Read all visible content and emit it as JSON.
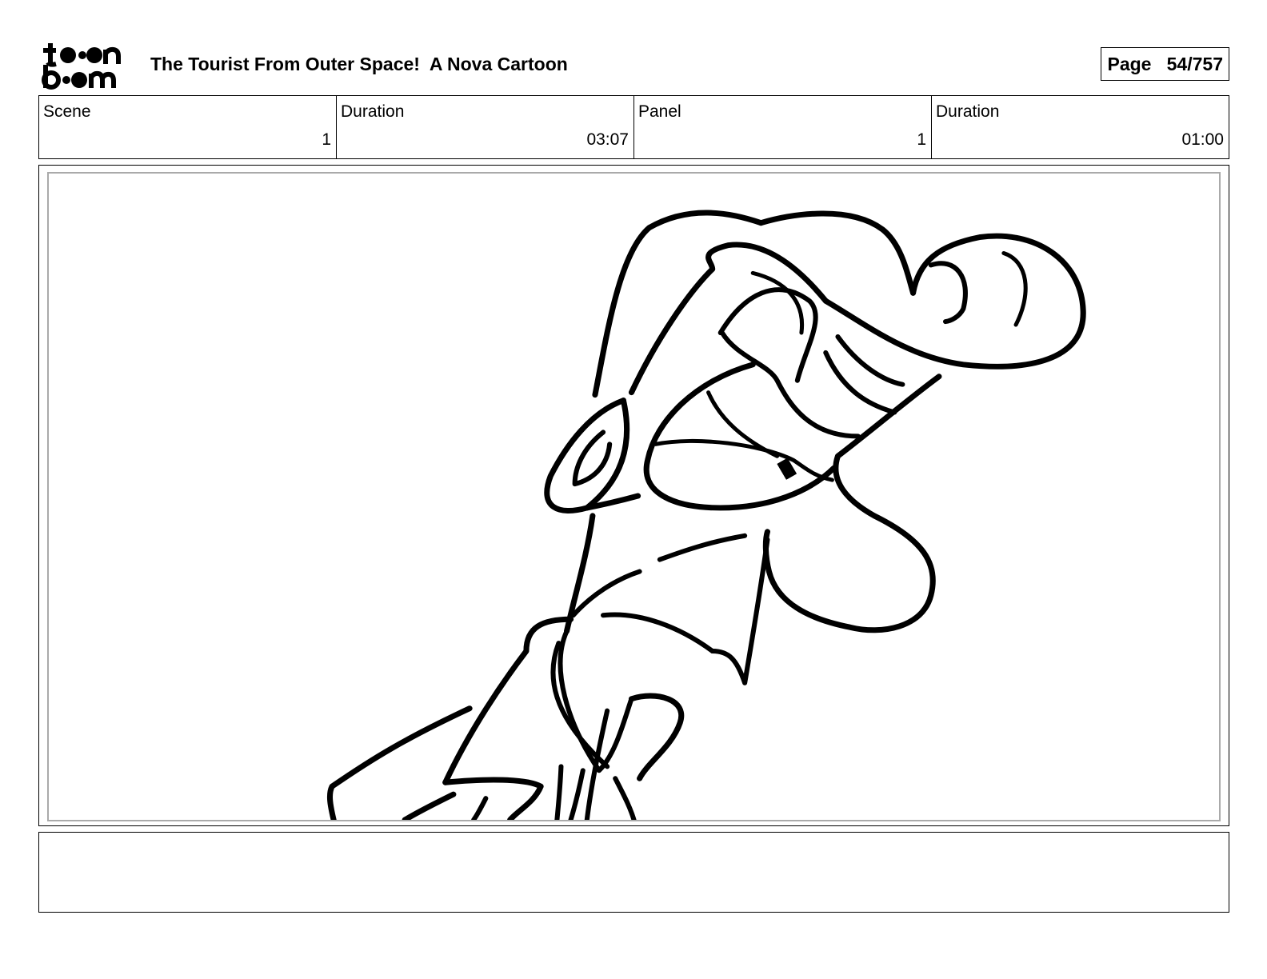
{
  "header": {
    "logo_text": "toonboom",
    "title": "The Tourist From Outer Space!  A Nova Cartoon",
    "page_label": "Page",
    "page_value": "54/757"
  },
  "info": {
    "scene_label": "Scene",
    "scene_value": "1",
    "scene_duration_label": "Duration",
    "scene_duration_value": "03:07",
    "panel_label": "Panel",
    "panel_value": "1",
    "panel_duration_label": "Duration",
    "panel_duration_value": "01:00"
  },
  "notes": {
    "text": ""
  }
}
